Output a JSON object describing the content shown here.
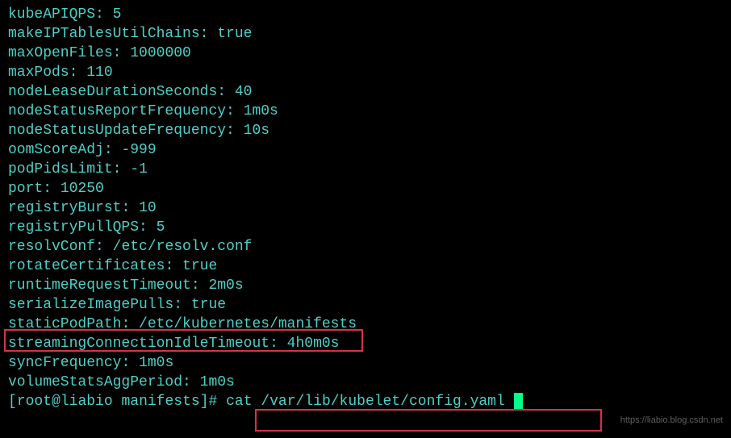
{
  "config": {
    "lines": [
      {
        "key": "kubeAPIQPS",
        "value": "5"
      },
      {
        "key": "makeIPTablesUtilChains",
        "value": "true"
      },
      {
        "key": "maxOpenFiles",
        "value": "1000000"
      },
      {
        "key": "maxPods",
        "value": "110"
      },
      {
        "key": "nodeLeaseDurationSeconds",
        "value": "40"
      },
      {
        "key": "nodeStatusReportFrequency",
        "value": "1m0s"
      },
      {
        "key": "nodeStatusUpdateFrequency",
        "value": "10s"
      },
      {
        "key": "oomScoreAdj",
        "value": "-999"
      },
      {
        "key": "podPidsLimit",
        "value": "-1"
      },
      {
        "key": "port",
        "value": "10250"
      },
      {
        "key": "registryBurst",
        "value": "10"
      },
      {
        "key": "registryPullQPS",
        "value": "5"
      },
      {
        "key": "resolvConf",
        "value": "/etc/resolv.conf"
      },
      {
        "key": "rotateCertificates",
        "value": "true"
      },
      {
        "key": "runtimeRequestTimeout",
        "value": "2m0s"
      },
      {
        "key": "serializeImagePulls",
        "value": "true"
      },
      {
        "key": "staticPodPath",
        "value": "/etc/kubernetes/manifests"
      },
      {
        "key": "streamingConnectionIdleTimeout",
        "value": "4h0m0s"
      },
      {
        "key": "syncFrequency",
        "value": "1m0s"
      },
      {
        "key": "volumeStatsAggPeriod",
        "value": "1m0s"
      }
    ]
  },
  "prompt": {
    "user": "root",
    "host": "liabio",
    "dir": "manifests",
    "symbol": "#",
    "command": "cat /var/lib/kubelet/config.yaml"
  },
  "watermark": "https://liabio.blog.csdn.net"
}
